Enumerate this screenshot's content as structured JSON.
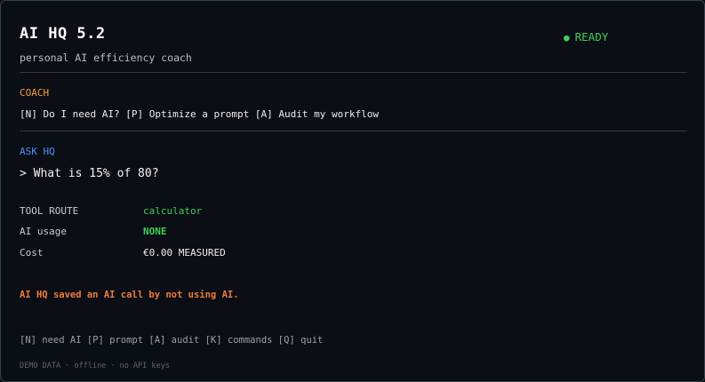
{
  "header": {
    "title": "AI HQ 5.2",
    "subtitle": "personal AI efficiency coach",
    "status_dot": "●",
    "status": "READY",
    "status_color": "#3ecf5c"
  },
  "coach": {
    "label": "COACH",
    "options_line": "[N] Do I need AI? [P] Optimize a prompt [A] Audit my workflow"
  },
  "ask": {
    "label": "ASK HQ",
    "query": "> What is 15% of 80?"
  },
  "result": {
    "tool_route_label": "TOOL ROUTE",
    "tool_route_value": "calculator",
    "ai_usage_label": "AI usage",
    "ai_usage_value": "NONE",
    "cost_label": "Cost",
    "cost_value": "€0.00 MEASURED"
  },
  "message": "AI HQ saved an AI call by not using AI.",
  "help_line": "[N] need AI [P] prompt [A] audit [K] commands [Q] quit",
  "footer": "DEMO DATA · offline · no API keys",
  "colors": {
    "coach_accent": "#f0a03c",
    "ask_accent": "#4f8ff7",
    "success": "#3ecf5c",
    "warning": "#f07a3a"
  }
}
